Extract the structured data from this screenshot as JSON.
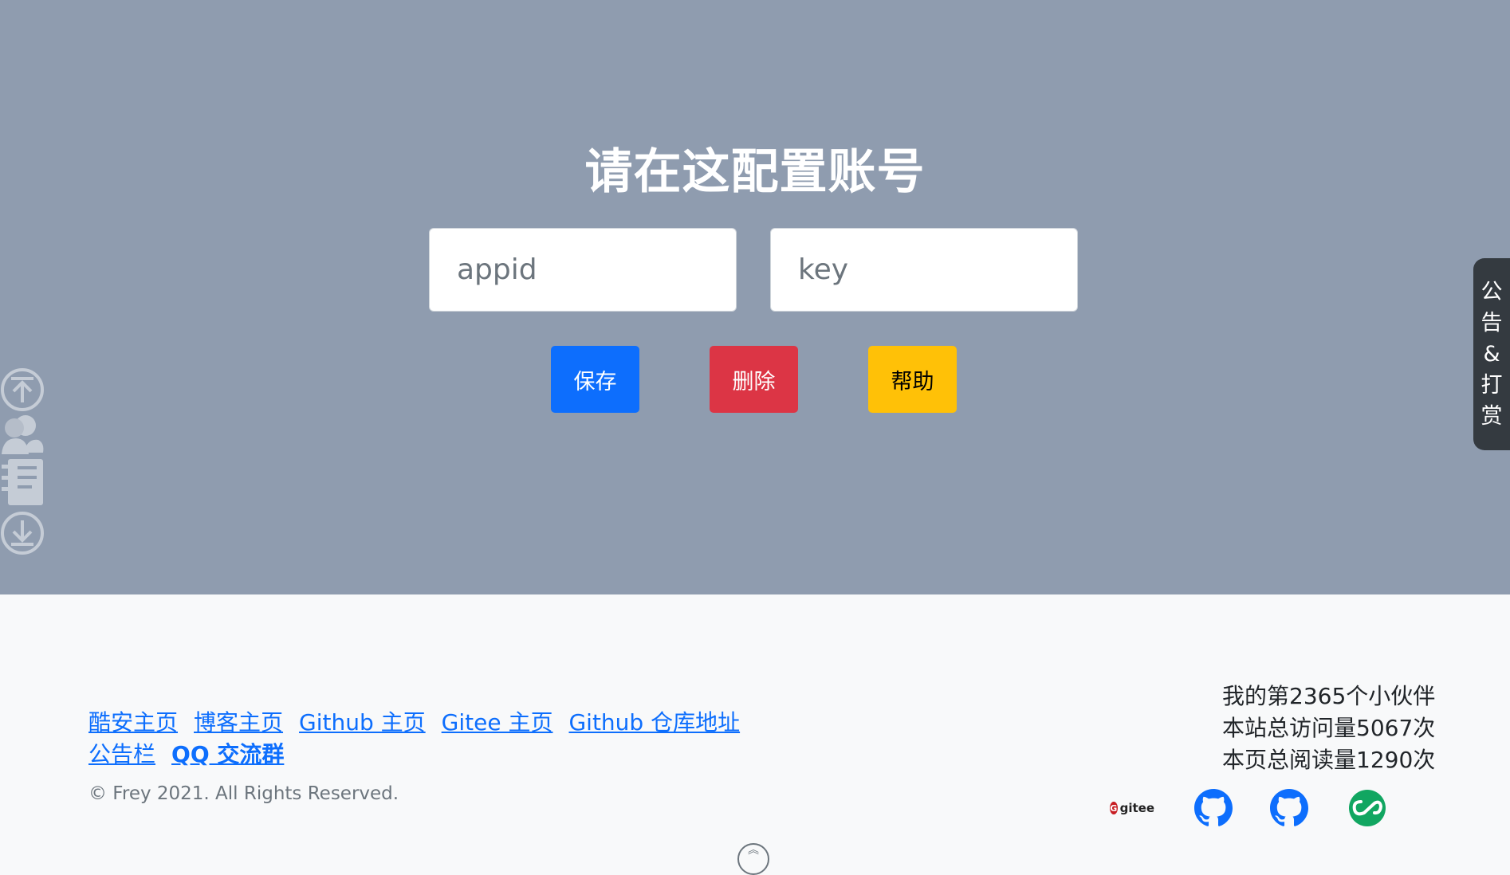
{
  "hero": {
    "title": "请在这配置账号",
    "appid_placeholder": "appid",
    "key_placeholder": "key",
    "save_label": "保存",
    "delete_label": "删除",
    "help_label": "帮助",
    "background_color": "#8f9caf"
  },
  "side_tools": [
    {
      "icon": "arrow-up-circle-icon"
    },
    {
      "icon": "user-icon"
    },
    {
      "icon": "notebook-icon"
    },
    {
      "icon": "arrow-down-circle-icon"
    }
  ],
  "notice_tab": {
    "label": "公告&打赏"
  },
  "footer": {
    "links_row1": [
      "酷安主页",
      "博客主页",
      "Github 主页",
      "Gitee 主页",
      "Github 仓库地址"
    ],
    "links_row2": [
      "公告栏",
      "QQ 交流群"
    ],
    "copyright": "© Frey 2021. All Rights Reserved.",
    "stats": [
      "我的第2365个小伙伴",
      "本站总访问量5067次",
      "本页总阅读量1290次"
    ],
    "gitee_badge": "gitee",
    "social_icons": [
      "gitee-icon",
      "github-icon",
      "github-icon",
      "coolapk-icon"
    ]
  },
  "colors": {
    "primary": "#0d6efd",
    "danger": "#dc3545",
    "warning": "#ffc107",
    "dark": "#343a40"
  }
}
